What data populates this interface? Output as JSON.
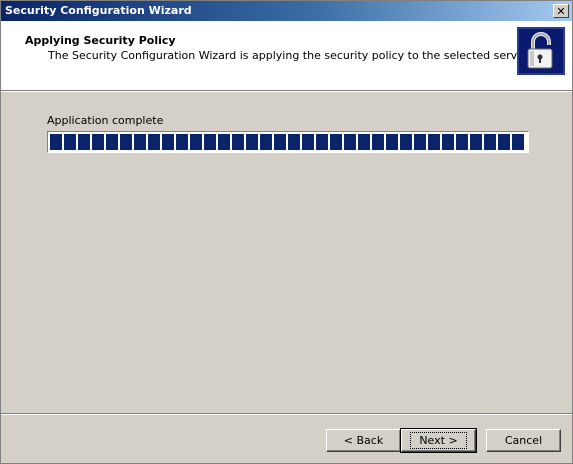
{
  "window": {
    "title": "Security Configuration Wizard",
    "close_glyph": "✕"
  },
  "header": {
    "title": "Applying Security Policy",
    "subtitle": "The Security Configuration Wizard is applying the security policy to the selected server.",
    "icon": "padlock-icon"
  },
  "main": {
    "status_label": "Application complete",
    "progress_fraction": 1.0
  },
  "footer": {
    "back_label": "< Back",
    "next_label": "Next >",
    "cancel_label": "Cancel"
  },
  "colors": {
    "titlebar_start": "#0a246a",
    "titlebar_end": "#a6caf0",
    "progress_fill": "#0a246a",
    "dialog_bg": "#d4d0c8"
  }
}
